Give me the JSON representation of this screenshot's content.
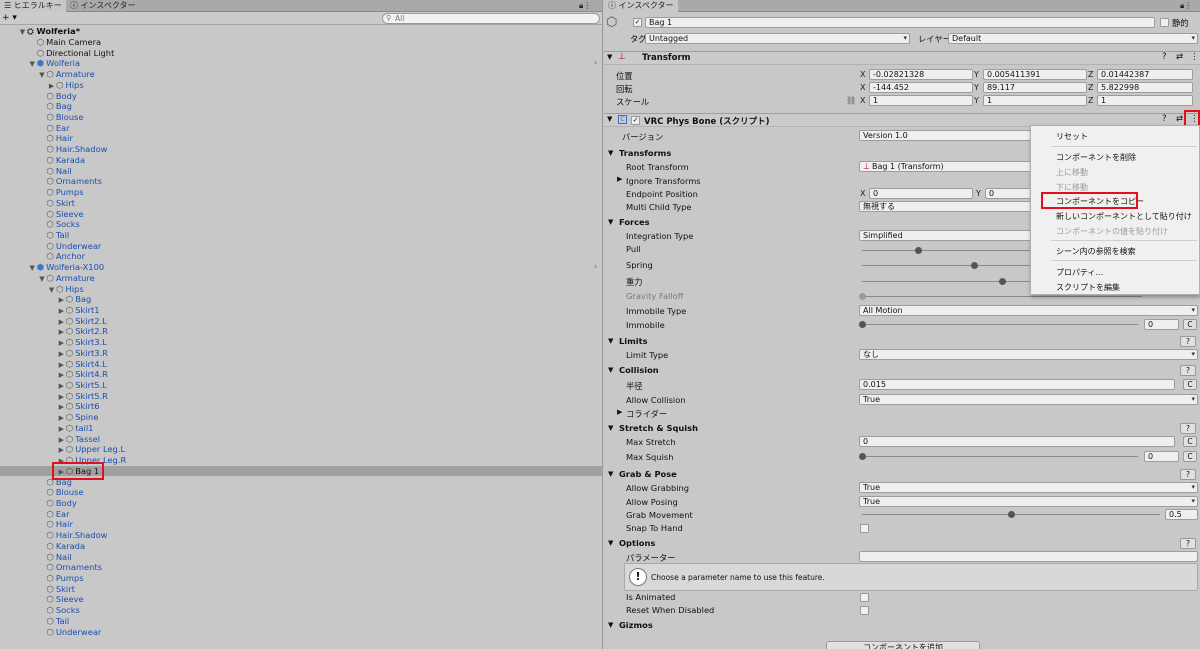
{
  "hierarchy": {
    "tab_hierarchy": "ヒエラルキー",
    "tab_inspector": "インスペクター",
    "add_label": "+ ▾",
    "search_placeholder": "All",
    "scene": "Wolferia*",
    "items": [
      {
        "label": "Main Camera",
        "indent": 1,
        "arrow": "",
        "blue": false,
        "icon": "cube-icon"
      },
      {
        "label": "Directional Light",
        "indent": 1,
        "arrow": "",
        "blue": false,
        "icon": "cube-icon"
      },
      {
        "label": "Wolferia",
        "indent": 1,
        "arrow": "▼",
        "blue": true,
        "icon": "prefab-icon"
      },
      {
        "label": "Armature",
        "indent": 2,
        "arrow": "▼",
        "blue": true,
        "icon": "cube-icon"
      },
      {
        "label": "Hips",
        "indent": 3,
        "arrow": "▶",
        "blue": true,
        "icon": "cube-icon"
      },
      {
        "label": "Body",
        "indent": 2,
        "arrow": "",
        "blue": true,
        "icon": "cube-icon"
      },
      {
        "label": "Bag",
        "indent": 2,
        "arrow": "",
        "blue": true,
        "icon": "cube-icon"
      },
      {
        "label": "Blouse",
        "indent": 2,
        "arrow": "",
        "blue": true,
        "icon": "cube-icon"
      },
      {
        "label": "Ear",
        "indent": 2,
        "arrow": "",
        "blue": true,
        "icon": "cube-icon"
      },
      {
        "label": "Hair",
        "indent": 2,
        "arrow": "",
        "blue": true,
        "icon": "cube-icon"
      },
      {
        "label": "Hair.Shadow",
        "indent": 2,
        "arrow": "",
        "blue": true,
        "icon": "cube-icon"
      },
      {
        "label": "Karada",
        "indent": 2,
        "arrow": "",
        "blue": true,
        "icon": "cube-icon"
      },
      {
        "label": "Nail",
        "indent": 2,
        "arrow": "",
        "blue": true,
        "icon": "cube-icon"
      },
      {
        "label": "Ornaments",
        "indent": 2,
        "arrow": "",
        "blue": true,
        "icon": "cube-icon"
      },
      {
        "label": "Pumps",
        "indent": 2,
        "arrow": "",
        "blue": true,
        "icon": "cube-icon"
      },
      {
        "label": "Skirt",
        "indent": 2,
        "arrow": "",
        "blue": true,
        "icon": "cube-icon"
      },
      {
        "label": "Sleeve",
        "indent": 2,
        "arrow": "",
        "blue": true,
        "icon": "cube-icon"
      },
      {
        "label": "Socks",
        "indent": 2,
        "arrow": "",
        "blue": true,
        "icon": "cube-icon"
      },
      {
        "label": "Tail",
        "indent": 2,
        "arrow": "",
        "blue": true,
        "icon": "cube-icon"
      },
      {
        "label": "Underwear",
        "indent": 2,
        "arrow": "",
        "blue": true,
        "icon": "cube-icon"
      },
      {
        "label": "Anchor",
        "indent": 2,
        "arrow": "",
        "blue": true,
        "icon": "cube-icon"
      },
      {
        "label": "Wolferia-X100",
        "indent": 1,
        "arrow": "▼",
        "blue": true,
        "icon": "prefab-icon"
      },
      {
        "label": "Armature",
        "indent": 2,
        "arrow": "▼",
        "blue": true,
        "icon": "cube-icon"
      },
      {
        "label": "Hips",
        "indent": 3,
        "arrow": "▼",
        "blue": true,
        "icon": "cube-icon"
      },
      {
        "label": "Bag",
        "indent": 4,
        "arrow": "▶",
        "blue": true,
        "icon": "cube-icon"
      },
      {
        "label": "Skirt1",
        "indent": 4,
        "arrow": "▶",
        "blue": true,
        "icon": "cube-icon"
      },
      {
        "label": "Skirt2.L",
        "indent": 4,
        "arrow": "▶",
        "blue": true,
        "icon": "cube-icon"
      },
      {
        "label": "Skirt2.R",
        "indent": 4,
        "arrow": "▶",
        "blue": true,
        "icon": "cube-icon"
      },
      {
        "label": "Skirt3.L",
        "indent": 4,
        "arrow": "▶",
        "blue": true,
        "icon": "cube-icon"
      },
      {
        "label": "Skirt3.R",
        "indent": 4,
        "arrow": "▶",
        "blue": true,
        "icon": "cube-icon"
      },
      {
        "label": "Skirt4.L",
        "indent": 4,
        "arrow": "▶",
        "blue": true,
        "icon": "cube-icon"
      },
      {
        "label": "Skirt4.R",
        "indent": 4,
        "arrow": "▶",
        "blue": true,
        "icon": "cube-icon"
      },
      {
        "label": "Skirt5.L",
        "indent": 4,
        "arrow": "▶",
        "blue": true,
        "icon": "cube-icon"
      },
      {
        "label": "Skirt5.R",
        "indent": 4,
        "arrow": "▶",
        "blue": true,
        "icon": "cube-icon"
      },
      {
        "label": "Skirt6",
        "indent": 4,
        "arrow": "▶",
        "blue": true,
        "icon": "cube-icon"
      },
      {
        "label": "Spine",
        "indent": 4,
        "arrow": "▶",
        "blue": true,
        "icon": "cube-icon"
      },
      {
        "label": "tail1",
        "indent": 4,
        "arrow": "▶",
        "blue": true,
        "icon": "cube-icon"
      },
      {
        "label": "Tassel",
        "indent": 4,
        "arrow": "▶",
        "blue": true,
        "icon": "cube-icon"
      },
      {
        "label": "Upper Leg.L",
        "indent": 4,
        "arrow": "▶",
        "blue": true,
        "icon": "cube-icon"
      },
      {
        "label": "Upper Leg.R",
        "indent": 4,
        "arrow": "▶",
        "blue": true,
        "icon": "cube-icon"
      },
      {
        "label": "Bag 1",
        "indent": 4,
        "arrow": "▶",
        "blue": false,
        "icon": "physbone-cube-icon",
        "selected": true
      },
      {
        "label": "Bag",
        "indent": 2,
        "arrow": "",
        "blue": true,
        "icon": "cube-icon"
      },
      {
        "label": "Blouse",
        "indent": 2,
        "arrow": "",
        "blue": true,
        "icon": "cube-icon"
      },
      {
        "label": "Body",
        "indent": 2,
        "arrow": "",
        "blue": true,
        "icon": "cube-icon"
      },
      {
        "label": "Ear",
        "indent": 2,
        "arrow": "",
        "blue": true,
        "icon": "cube-icon"
      },
      {
        "label": "Hair",
        "indent": 2,
        "arrow": "",
        "blue": true,
        "icon": "cube-icon"
      },
      {
        "label": "Hair.Shadow",
        "indent": 2,
        "arrow": "",
        "blue": true,
        "icon": "cube-icon"
      },
      {
        "label": "Karada",
        "indent": 2,
        "arrow": "",
        "blue": true,
        "icon": "cube-icon"
      },
      {
        "label": "Nail",
        "indent": 2,
        "arrow": "",
        "blue": true,
        "icon": "cube-icon"
      },
      {
        "label": "Ornaments",
        "indent": 2,
        "arrow": "",
        "blue": true,
        "icon": "cube-icon"
      },
      {
        "label": "Pumps",
        "indent": 2,
        "arrow": "",
        "blue": true,
        "icon": "cube-icon"
      },
      {
        "label": "Skirt",
        "indent": 2,
        "arrow": "",
        "blue": true,
        "icon": "cube-icon"
      },
      {
        "label": "Sleeve",
        "indent": 2,
        "arrow": "",
        "blue": true,
        "icon": "cube-icon"
      },
      {
        "label": "Socks",
        "indent": 2,
        "arrow": "",
        "blue": true,
        "icon": "cube-icon"
      },
      {
        "label": "Tail",
        "indent": 2,
        "arrow": "",
        "blue": true,
        "icon": "cube-icon"
      },
      {
        "label": "Underwear",
        "indent": 2,
        "arrow": "",
        "blue": true,
        "icon": "cube-icon"
      }
    ]
  },
  "inspector": {
    "tab": "インスペクター",
    "object_name": "Bag 1",
    "static_label": "静的",
    "tag_label": "タグ",
    "tag_value": "Untagged",
    "layer_label": "レイヤー",
    "layer_value": "Default",
    "transform": {
      "title": "Transform",
      "position_label": "位置",
      "rotation_label": "回転",
      "scale_label": "スケール",
      "position": [
        "-0.02821328",
        "0.005411391",
        "0.01442387"
      ],
      "rotation": [
        "-144.452",
        "89.117",
        "5.822998"
      ],
      "scale": [
        "1",
        "1",
        "1"
      ],
      "axes": [
        "X",
        "Y",
        "Z"
      ]
    },
    "physbone": {
      "title": "VRC Phys Bone (スクリプト)",
      "version_label": "バージョン",
      "version_value": "Version 1.0",
      "transforms_section": "Transforms",
      "root_transform_label": "Root Transform",
      "root_transform_value": "Bag 1 (Transform)",
      "ignore_transforms_label": "Ignore Transforms",
      "endpoint_label": "Endpoint Position",
      "endpoint_x": "0",
      "endpoint_y": "0",
      "multi_child_label": "Multi Child Type",
      "multi_child_value": "無視する",
      "forces_section": "Forces",
      "integration_label": "Integration Type",
      "integration_value": "Simplified",
      "pull_label": "Pull",
      "spring_label": "Spring",
      "gravity_label": "重力",
      "gravity_falloff_label": "Gravity Falloff",
      "gravity_falloff_value": "0",
      "immobile_type_label": "Immobile Type",
      "immobile_type_value": "All Motion",
      "immobile_label": "Immobile",
      "immobile_value": "0",
      "limits_section": "Limits",
      "limit_type_label": "Limit Type",
      "limit_type_value": "なし",
      "collision_section": "Collision",
      "radius_label": "半径",
      "radius_value": "0.015",
      "allow_collision_label": "Allow Collision",
      "allow_collision_value": "True",
      "colliders_label": "コライダー",
      "stretch_section": "Stretch & Squish",
      "max_stretch_label": "Max Stretch",
      "max_stretch_value": "0",
      "max_squish_label": "Max Squish",
      "max_squish_value": "0",
      "grab_section": "Grab & Pose",
      "allow_grabbing_label": "Allow Grabbing",
      "allow_grabbing_value": "True",
      "allow_posing_label": "Allow Posing",
      "allow_posing_value": "True",
      "grab_movement_label": "Grab Movement",
      "grab_movement_value": "0.5",
      "snap_to_hand_label": "Snap To Hand",
      "options_section": "Options",
      "parameter_label": "パラメーター",
      "help_text": "Choose a parameter name to use this feature.",
      "is_animated_label": "Is Animated",
      "reset_disabled_label": "Reset When Disabled",
      "gizmos_section": "Gizmos",
      "c_label": "C",
      "q_label": "?"
    },
    "add_component": "コンポーネントを追加"
  },
  "context_menu": {
    "items": [
      {
        "label": "リセット",
        "disabled": false
      },
      {
        "label": "コンポーネントを削除",
        "disabled": false
      },
      {
        "label": "上に移動",
        "disabled": true
      },
      {
        "label": "下に移動",
        "disabled": true
      },
      {
        "label": "コンポーネントをコピー",
        "disabled": false,
        "highlight": true
      },
      {
        "label": "新しいコンポーネントとして貼り付け",
        "disabled": false
      },
      {
        "label": "コンポーネントの値を貼り付け",
        "disabled": true
      },
      {
        "label": "シーン内の参照を検索",
        "disabled": false
      },
      {
        "label": "プロパティ...",
        "disabled": false
      },
      {
        "label": "スクリプトを編集",
        "disabled": false
      }
    ]
  },
  "sliders": {
    "pull": 0.2,
    "spring": 0.4,
    "gravity": 0.5,
    "gravity_falloff": 0,
    "immobile": 0,
    "max_squish": 0,
    "grab_movement": 0.5
  }
}
